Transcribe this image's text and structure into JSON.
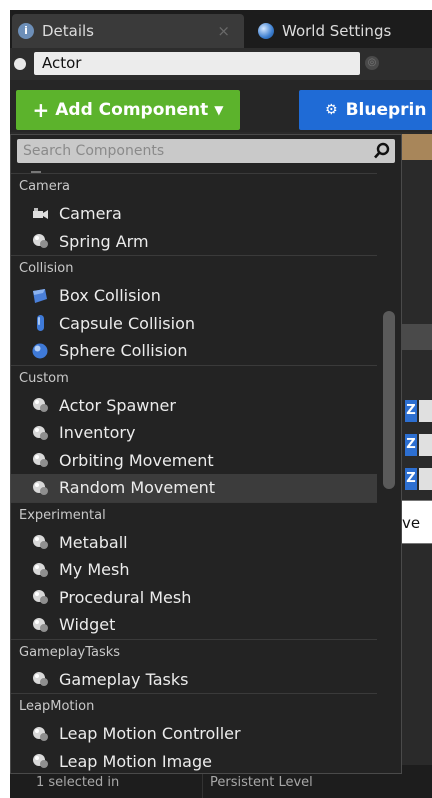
{
  "tabs": {
    "details_label": "Details",
    "world_settings_label": "World Settings"
  },
  "actor": {
    "name": "Actor"
  },
  "toolbar": {
    "add_component_label": "Add Component",
    "blueprint_label": "Blueprin"
  },
  "search": {
    "placeholder": "Search Components"
  },
  "menu": {
    "categories": [
      {
        "name": "Camera",
        "items": [
          {
            "label": "Camera",
            "icon": "camera-icon"
          },
          {
            "label": "Spring Arm",
            "icon": "component-icon"
          }
        ]
      },
      {
        "name": "Collision",
        "items": [
          {
            "label": "Box Collision",
            "icon": "box-collision-icon"
          },
          {
            "label": "Capsule Collision",
            "icon": "capsule-collision-icon"
          },
          {
            "label": "Sphere Collision",
            "icon": "sphere-collision-icon"
          }
        ]
      },
      {
        "name": "Custom",
        "items": [
          {
            "label": "Actor Spawner",
            "icon": "component-icon"
          },
          {
            "label": "Inventory",
            "icon": "component-icon"
          },
          {
            "label": "Orbiting Movement",
            "icon": "component-icon"
          },
          {
            "label": "Random Movement",
            "icon": "component-icon"
          }
        ]
      },
      {
        "name": "Experimental",
        "items": [
          {
            "label": "Metaball",
            "icon": "component-icon"
          },
          {
            "label": "My Mesh",
            "icon": "component-icon"
          },
          {
            "label": "Procedural Mesh",
            "icon": "component-icon"
          },
          {
            "label": "Widget",
            "icon": "component-icon"
          }
        ]
      },
      {
        "name": "GameplayTasks",
        "items": [
          {
            "label": "Gameplay Tasks",
            "icon": "component-icon"
          }
        ]
      },
      {
        "name": "LeapMotion",
        "items": [
          {
            "label": "Leap Motion Controller",
            "icon": "component-icon"
          },
          {
            "label": "Leap Motion Image",
            "icon": "component-icon"
          }
        ]
      }
    ],
    "hovered_item": "Random Movement"
  },
  "tooltip": {
    "text": "Random Move"
  },
  "background": {
    "axis_label": "Z"
  },
  "status": {
    "selection": "1 selected in",
    "level": "Persistent Level"
  },
  "colors": {
    "add_button": "#5cb32c",
    "blueprint_button": "#1f6bd6",
    "panel_bg": "#232323"
  }
}
